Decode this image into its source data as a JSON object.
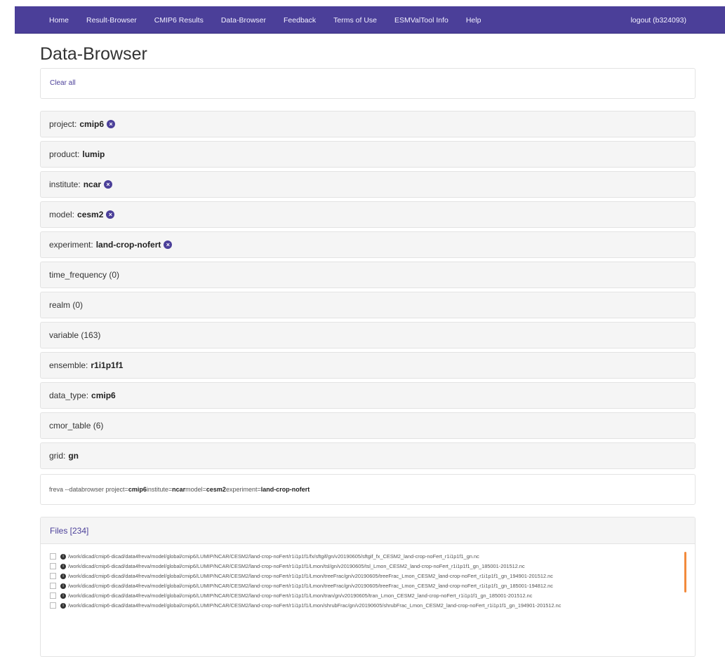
{
  "nav": {
    "items": [
      "Home",
      "Result-Browser",
      "CMIP6 Results",
      "Data-Browser",
      "Feedback",
      "Terms of Use",
      "ESMValTool Info",
      "Help"
    ],
    "logout": "logout (b324093)"
  },
  "page": {
    "title": "Data-Browser",
    "clear_all": "Clear all"
  },
  "facets": [
    {
      "label": "project:",
      "value": "cmip6",
      "removable": true
    },
    {
      "label": "product:",
      "value": "lumip",
      "removable": false
    },
    {
      "label": "institute:",
      "value": "ncar",
      "removable": true
    },
    {
      "label": "model:",
      "value": "cesm2",
      "removable": true
    },
    {
      "label": "experiment:",
      "value": "land-crop-nofert",
      "removable": true
    },
    {
      "label": "time_frequency (0)",
      "value": "",
      "removable": false
    },
    {
      "label": "realm (0)",
      "value": "",
      "removable": false
    },
    {
      "label": "variable (163)",
      "value": "",
      "removable": false
    },
    {
      "label": "ensemble:",
      "value": "r1i1p1f1",
      "removable": false
    },
    {
      "label": "data_type:",
      "value": "cmip6",
      "removable": false
    },
    {
      "label": "cmor_table (6)",
      "value": "",
      "removable": false
    },
    {
      "label": "grid:",
      "value": "gn",
      "removable": false
    }
  ],
  "command": {
    "prefix": "freva --databrowser project=",
    "project": "cmip6",
    "institute_label": " institute=",
    "institute": "ncar",
    "model_label": " model=",
    "model": "cesm2",
    "experiment_label": " experiment=",
    "experiment": "land-crop-nofert"
  },
  "files": {
    "header": "Files [234]",
    "items": [
      "/work/dicad/cmip6-dicad/data4freva/model/global/cmip6/LUMIP/NCAR/CESM2/land-crop-noFert/r1i1p1f1/fx/sftgif/gn/v20190605/sftgif_fx_CESM2_land-crop-noFert_r1i1p1f1_gn.nc",
      "/work/dicad/cmip6-dicad/data4freva/model/global/cmip6/LUMIP/NCAR/CESM2/land-crop-noFert/r1i1p1f1/Lmon/tsl/gn/v20190605/tsl_Lmon_CESM2_land-crop-noFert_r1i1p1f1_gn_185001-201512.nc",
      "/work/dicad/cmip6-dicad/data4freva/model/global/cmip6/LUMIP/NCAR/CESM2/land-crop-noFert/r1i1p1f1/Lmon/treeFrac/gn/v20190605/treeFrac_Lmon_CESM2_land-crop-noFert_r1i1p1f1_gn_194901-201512.nc",
      "/work/dicad/cmip6-dicad/data4freva/model/global/cmip6/LUMIP/NCAR/CESM2/land-crop-noFert/r1i1p1f1/Lmon/treeFrac/gn/v20190605/treeFrac_Lmon_CESM2_land-crop-noFert_r1i1p1f1_gn_185001-194812.nc",
      "/work/dicad/cmip6-dicad/data4freva/model/global/cmip6/LUMIP/NCAR/CESM2/land-crop-noFert/r1i1p1f1/Lmon/tran/gn/v20190605/tran_Lmon_CESM2_land-crop-noFert_r1i1p1f1_gn_185001-201512.nc",
      "/work/dicad/cmip6-dicad/data4freva/model/global/cmip6/LUMIP/NCAR/CESM2/land-crop-noFert/r1i1p1f1/Lmon/shrubFrac/gn/v20190605/shrubFrac_Lmon_CESM2_land-crop-noFert_r1i1p1f1_gn_194901-201512.nc"
    ]
  }
}
